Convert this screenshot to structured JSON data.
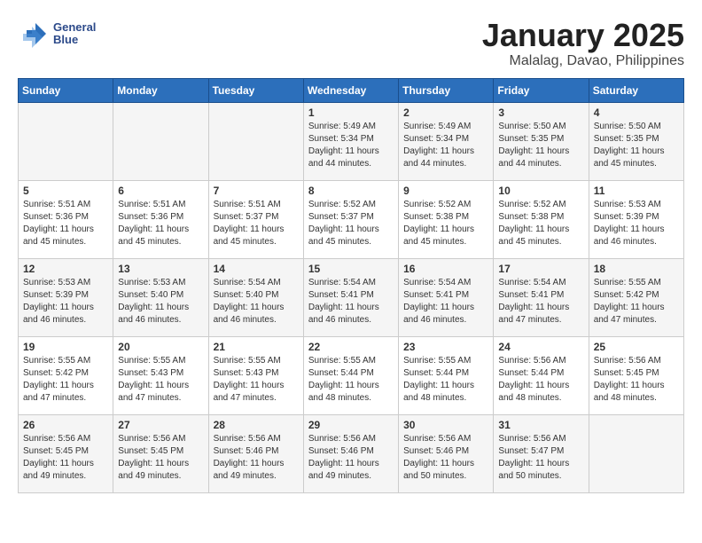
{
  "logo": {
    "line1": "General",
    "line2": "Blue"
  },
  "header": {
    "month": "January 2025",
    "location": "Malalag, Davao, Philippines"
  },
  "weekdays": [
    "Sunday",
    "Monday",
    "Tuesday",
    "Wednesday",
    "Thursday",
    "Friday",
    "Saturday"
  ],
  "weeks": [
    [
      {
        "day": "",
        "info": ""
      },
      {
        "day": "",
        "info": ""
      },
      {
        "day": "",
        "info": ""
      },
      {
        "day": "1",
        "info": "Sunrise: 5:49 AM\nSunset: 5:34 PM\nDaylight: 11 hours\nand 44 minutes."
      },
      {
        "day": "2",
        "info": "Sunrise: 5:49 AM\nSunset: 5:34 PM\nDaylight: 11 hours\nand 44 minutes."
      },
      {
        "day": "3",
        "info": "Sunrise: 5:50 AM\nSunset: 5:35 PM\nDaylight: 11 hours\nand 44 minutes."
      },
      {
        "day": "4",
        "info": "Sunrise: 5:50 AM\nSunset: 5:35 PM\nDaylight: 11 hours\nand 45 minutes."
      }
    ],
    [
      {
        "day": "5",
        "info": "Sunrise: 5:51 AM\nSunset: 5:36 PM\nDaylight: 11 hours\nand 45 minutes."
      },
      {
        "day": "6",
        "info": "Sunrise: 5:51 AM\nSunset: 5:36 PM\nDaylight: 11 hours\nand 45 minutes."
      },
      {
        "day": "7",
        "info": "Sunrise: 5:51 AM\nSunset: 5:37 PM\nDaylight: 11 hours\nand 45 minutes."
      },
      {
        "day": "8",
        "info": "Sunrise: 5:52 AM\nSunset: 5:37 PM\nDaylight: 11 hours\nand 45 minutes."
      },
      {
        "day": "9",
        "info": "Sunrise: 5:52 AM\nSunset: 5:38 PM\nDaylight: 11 hours\nand 45 minutes."
      },
      {
        "day": "10",
        "info": "Sunrise: 5:52 AM\nSunset: 5:38 PM\nDaylight: 11 hours\nand 45 minutes."
      },
      {
        "day": "11",
        "info": "Sunrise: 5:53 AM\nSunset: 5:39 PM\nDaylight: 11 hours\nand 46 minutes."
      }
    ],
    [
      {
        "day": "12",
        "info": "Sunrise: 5:53 AM\nSunset: 5:39 PM\nDaylight: 11 hours\nand 46 minutes."
      },
      {
        "day": "13",
        "info": "Sunrise: 5:53 AM\nSunset: 5:40 PM\nDaylight: 11 hours\nand 46 minutes."
      },
      {
        "day": "14",
        "info": "Sunrise: 5:54 AM\nSunset: 5:40 PM\nDaylight: 11 hours\nand 46 minutes."
      },
      {
        "day": "15",
        "info": "Sunrise: 5:54 AM\nSunset: 5:41 PM\nDaylight: 11 hours\nand 46 minutes."
      },
      {
        "day": "16",
        "info": "Sunrise: 5:54 AM\nSunset: 5:41 PM\nDaylight: 11 hours\nand 46 minutes."
      },
      {
        "day": "17",
        "info": "Sunrise: 5:54 AM\nSunset: 5:41 PM\nDaylight: 11 hours\nand 47 minutes."
      },
      {
        "day": "18",
        "info": "Sunrise: 5:55 AM\nSunset: 5:42 PM\nDaylight: 11 hours\nand 47 minutes."
      }
    ],
    [
      {
        "day": "19",
        "info": "Sunrise: 5:55 AM\nSunset: 5:42 PM\nDaylight: 11 hours\nand 47 minutes."
      },
      {
        "day": "20",
        "info": "Sunrise: 5:55 AM\nSunset: 5:43 PM\nDaylight: 11 hours\nand 47 minutes."
      },
      {
        "day": "21",
        "info": "Sunrise: 5:55 AM\nSunset: 5:43 PM\nDaylight: 11 hours\nand 47 minutes."
      },
      {
        "day": "22",
        "info": "Sunrise: 5:55 AM\nSunset: 5:44 PM\nDaylight: 11 hours\nand 48 minutes."
      },
      {
        "day": "23",
        "info": "Sunrise: 5:55 AM\nSunset: 5:44 PM\nDaylight: 11 hours\nand 48 minutes."
      },
      {
        "day": "24",
        "info": "Sunrise: 5:56 AM\nSunset: 5:44 PM\nDaylight: 11 hours\nand 48 minutes."
      },
      {
        "day": "25",
        "info": "Sunrise: 5:56 AM\nSunset: 5:45 PM\nDaylight: 11 hours\nand 48 minutes."
      }
    ],
    [
      {
        "day": "26",
        "info": "Sunrise: 5:56 AM\nSunset: 5:45 PM\nDaylight: 11 hours\nand 49 minutes."
      },
      {
        "day": "27",
        "info": "Sunrise: 5:56 AM\nSunset: 5:45 PM\nDaylight: 11 hours\nand 49 minutes."
      },
      {
        "day": "28",
        "info": "Sunrise: 5:56 AM\nSunset: 5:46 PM\nDaylight: 11 hours\nand 49 minutes."
      },
      {
        "day": "29",
        "info": "Sunrise: 5:56 AM\nSunset: 5:46 PM\nDaylight: 11 hours\nand 49 minutes."
      },
      {
        "day": "30",
        "info": "Sunrise: 5:56 AM\nSunset: 5:46 PM\nDaylight: 11 hours\nand 50 minutes."
      },
      {
        "day": "31",
        "info": "Sunrise: 5:56 AM\nSunset: 5:47 PM\nDaylight: 11 hours\nand 50 minutes."
      },
      {
        "day": "",
        "info": ""
      }
    ]
  ]
}
